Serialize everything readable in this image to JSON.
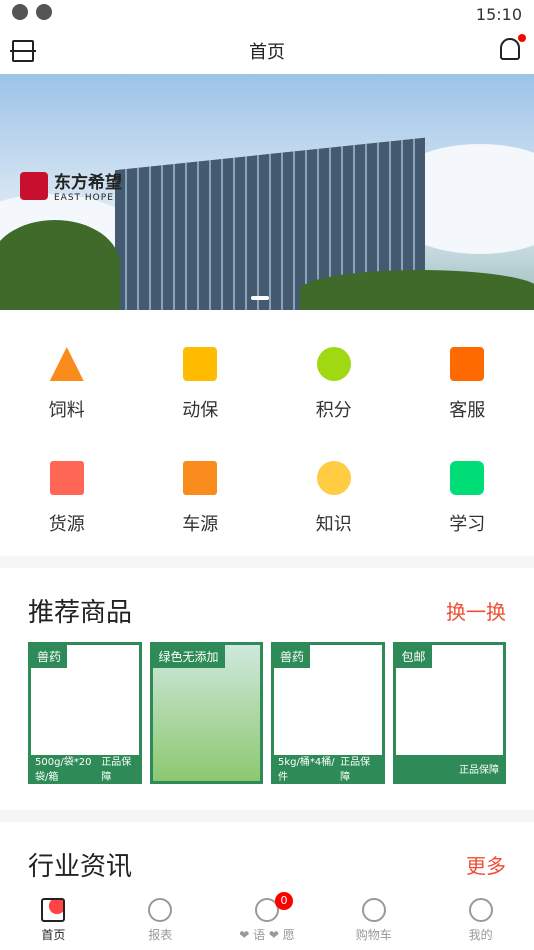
{
  "status": {
    "time": "15:10"
  },
  "header": {
    "title": "首页"
  },
  "banner": {
    "logo_cn": "东方希望",
    "logo_en": "EAST HOPE"
  },
  "grid": [
    {
      "label": "饲料",
      "icon": "feed-icon",
      "color": "#fa8c1e"
    },
    {
      "label": "动保",
      "icon": "medicine-jar-icon",
      "color": "#ffbb00"
    },
    {
      "label": "积分",
      "icon": "points-star-icon",
      "color": "#a0d911"
    },
    {
      "label": "客服",
      "icon": "shopping-bag-icon",
      "color": "#ff6a00"
    },
    {
      "label": "货源",
      "icon": "drawer-icon",
      "color": "#ff6655"
    },
    {
      "label": "车源",
      "icon": "truck-icon",
      "color": "#fa8c1e"
    },
    {
      "label": "知识",
      "icon": "face-icon",
      "color": "#ffcc44"
    },
    {
      "label": "学习",
      "icon": "tv-icon",
      "color": "#00dd77"
    }
  ],
  "recommend": {
    "title": "推荐商品",
    "action": "换一换",
    "products": [
      {
        "tag": "兽药",
        "spec": "500g/袋*20袋/箱",
        "seal": "正品保障"
      },
      {
        "tag": "绿色无添加",
        "spec": "",
        "seal": ""
      },
      {
        "tag": "兽药",
        "spec": "5kg/桶*4桶/件",
        "seal": "正品保障"
      },
      {
        "tag": "包邮",
        "spec": "",
        "seal": "正品保障"
      }
    ]
  },
  "news": {
    "title": "行业资讯",
    "action": "更多"
  },
  "tabbar": [
    {
      "label": "首页",
      "icon": "home-icon"
    },
    {
      "label": "报表",
      "icon": "pie-chart-icon"
    },
    {
      "label": "❤ 语 ❤ 愿",
      "icon": "heart-icon",
      "badge": "0"
    },
    {
      "label": "购物车",
      "icon": "cart-icon"
    },
    {
      "label": "我的",
      "icon": "user-icon"
    }
  ]
}
